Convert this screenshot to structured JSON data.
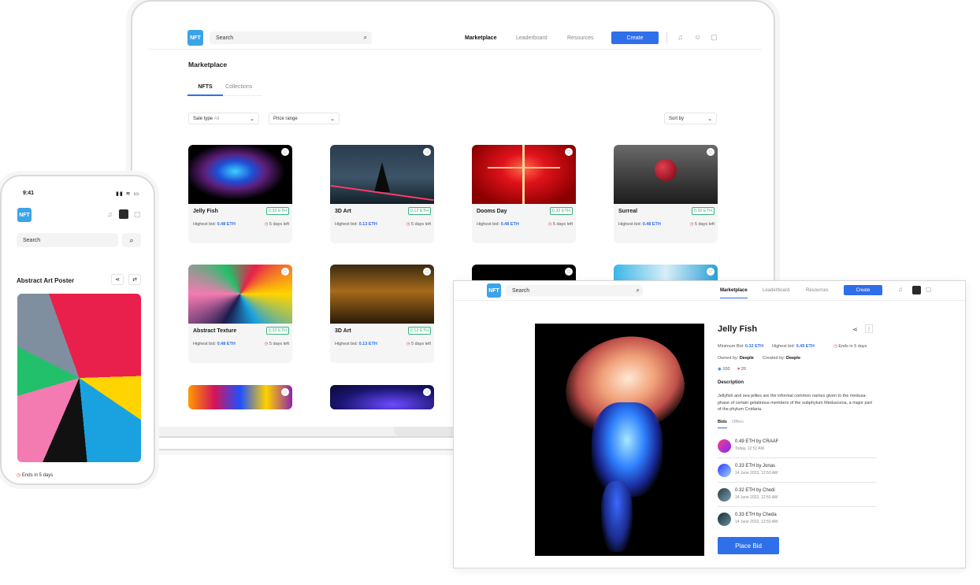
{
  "laptop": {
    "logo": "NFT",
    "search_placeholder": "Search",
    "nav": [
      "Marketplace",
      "Leaderboard",
      "Resources"
    ],
    "create_label": "Create",
    "page_title": "Marketplace",
    "tabs": [
      "NFTS",
      "Collections"
    ],
    "filters": {
      "sale_type": "Sale type",
      "sale_type_value": "All",
      "price_range": "Price range",
      "sort_by": "Sort by"
    },
    "cards": [
      {
        "name": "Jelly Fish",
        "price": "0.32 ETH",
        "bid_label": "Highest bid:",
        "bid": "0.48 ETH",
        "left": "5 days left"
      },
      {
        "name": "3D Art",
        "price": "0.12 ETH",
        "bid_label": "Highest bid:",
        "bid": "0.13 ETH",
        "left": "5 days left"
      },
      {
        "name": "Dooms Day",
        "price": "0.32 ETH",
        "bid_label": "Highest bid:",
        "bid": "0.48 ETH",
        "left": "5 days left"
      },
      {
        "name": "Surreal",
        "price": "0.32 ETH",
        "bid_label": "Highest bid:",
        "bid": "0.48 ETH",
        "left": "5 days left"
      },
      {
        "name": "Abstract Texture",
        "price": "0.32 ETH",
        "bid_label": "Highest bid:",
        "bid": "0.48 ETH",
        "left": "5 days left"
      },
      {
        "name": "3D Art",
        "price": "0.12 ETH",
        "bid_label": "Highest bid:",
        "bid": "0.13 ETH",
        "left": "5 days left"
      }
    ]
  },
  "phone": {
    "time": "9:41",
    "logo": "NFT",
    "search_placeholder": "Search",
    "title": "Abstract Art Poster",
    "ends": "Ends in 5 days"
  },
  "detail": {
    "logo": "NFT",
    "search_placeholder": "Search",
    "nav": [
      "Marketplace",
      "Leaderboard",
      "Resources"
    ],
    "create_label": "Create",
    "title": "Jelly Fish",
    "min_bid_label": "Minimum Bid:",
    "min_bid": "0.32 ETH",
    "highest_bid_label": "Highest bid:",
    "highest_bid": "0.49 ETH",
    "ends": "Ends in 5 days",
    "owned_label": "Owned by:",
    "owned": "Deeple",
    "created_label": "Created by:",
    "created": "Deeple",
    "views": "100",
    "likes": "20",
    "description_label": "Description",
    "description": "Jellyfish and sea jellies are the informal common names given to the medusa-phase of certain gelatinous members of the subphylum Medusozoa, a major part of the phylum Cnidaria.",
    "tabs": [
      "Bids",
      "Offers"
    ],
    "bids": [
      {
        "line": "0.49 ETH by CRAAF",
        "time": "Today, 12:51 AM"
      },
      {
        "line": "0.33 ETH by Jonas",
        "time": "14 June 2022, 12:50 AM"
      },
      {
        "line": "0.32 ETH by Chedi",
        "time": "14 June 2022, 12:50 AM"
      },
      {
        "line": "0.33 ETH by Cheda",
        "time": "14 June 2022, 12:50 AM"
      }
    ],
    "place_bid": "Place Bid"
  }
}
